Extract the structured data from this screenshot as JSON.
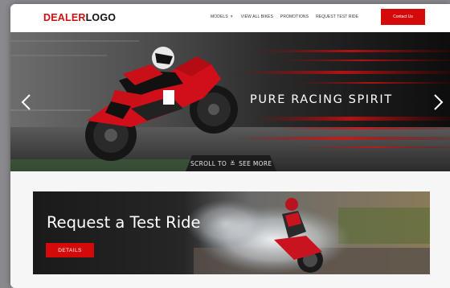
{
  "header": {
    "logo_part1": "DEALER",
    "logo_part2": "LOGO",
    "nav": [
      {
        "label": "MODELS"
      },
      {
        "label": "VIEW ALL BIKES"
      },
      {
        "label": "PROMOTIONS"
      },
      {
        "label": "REQUEST TEST RIDE"
      }
    ],
    "contact_label": "Contact Us"
  },
  "hero": {
    "tagline": "PURE RACING SPIRIT",
    "scroll_label_1": "SCROLL TO",
    "scroll_label_2": "SEE MORE"
  },
  "test_ride": {
    "title": "Request a Test Ride",
    "button_label": "DETAILS"
  },
  "colors": {
    "brand_red": "#d40a0a",
    "dark": "#1c1c1c"
  },
  "icons": [
    "chevron-down-icon",
    "arrow-left-icon",
    "arrow-right-icon",
    "double-chevron-down-icon"
  ]
}
